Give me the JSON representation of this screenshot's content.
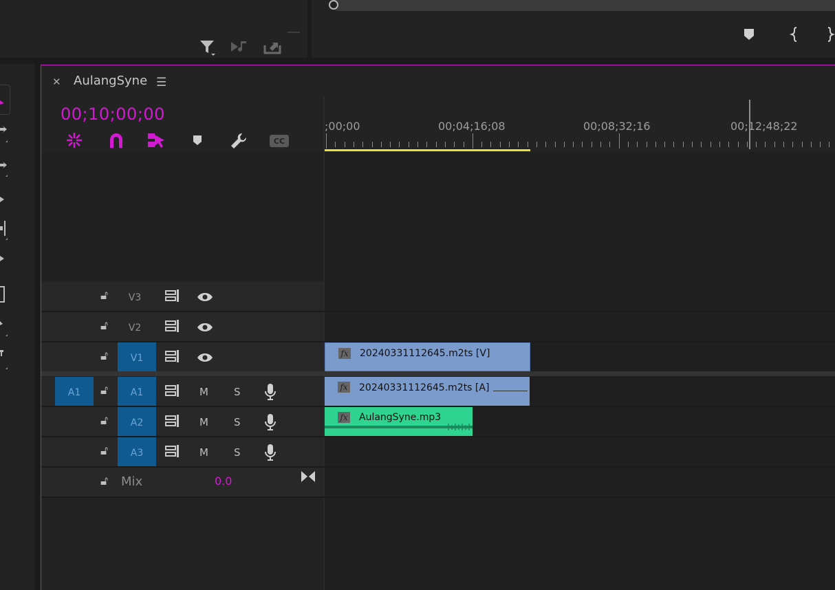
{
  "sequence": {
    "name": "AulangSyne",
    "timecode": "00;10;00;00"
  },
  "toolbar_icons": [
    "nest-icon",
    "snap-magnet-icon",
    "linked-selection-icon",
    "marker-icon",
    "wrench-icon",
    "captions-icon"
  ],
  "ruler": {
    "labels": [
      ";00;00",
      "00;04;16;08",
      "00;08;32;16",
      "00;12;48;22"
    ]
  },
  "tracks": {
    "video": [
      {
        "name": "V3",
        "active": false
      },
      {
        "name": "V2",
        "active": false
      },
      {
        "name": "V1",
        "active": true
      }
    ],
    "audio": [
      {
        "name": "A1",
        "source": "A1",
        "m": "M",
        "s": "S"
      },
      {
        "name": "A2",
        "m": "M",
        "s": "S"
      },
      {
        "name": "A3",
        "m": "M",
        "s": "S"
      }
    ],
    "mix": {
      "label": "Mix",
      "value": "0.0"
    }
  },
  "clips": {
    "v1": {
      "label": "20240331112645.m2ts [V]",
      "fx": "fx"
    },
    "a1": {
      "label": "20240331112645.m2ts [A]",
      "fx": "fx"
    },
    "a2": {
      "label": "AulangSyne.mp3",
      "fx": "fx"
    }
  },
  "colors": {
    "accent": "#d21ad2",
    "video_clip": "#7c9bcd",
    "audio_clip_mp3": "#2ed48f",
    "track_target": "#0f5a91",
    "work_area": "#e6e23a"
  }
}
